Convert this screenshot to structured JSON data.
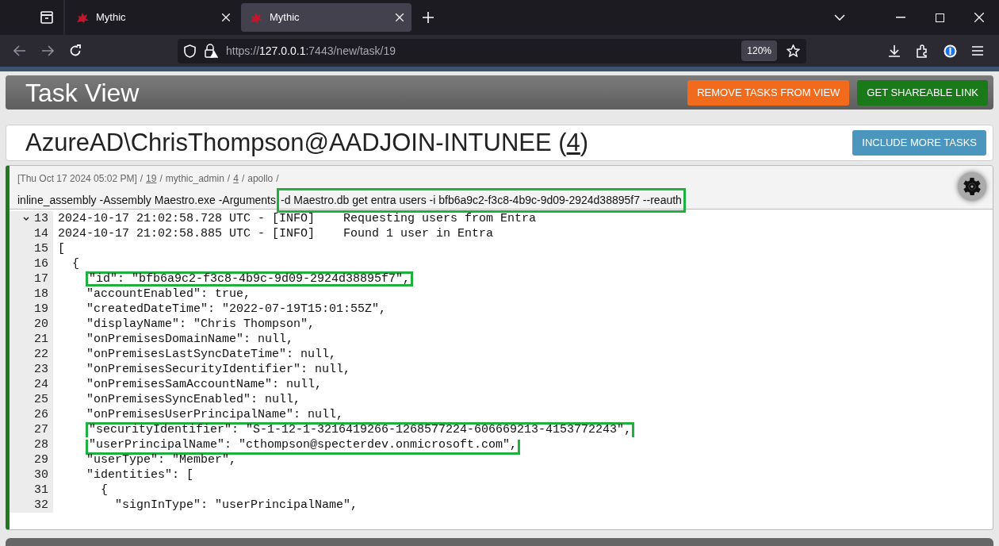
{
  "browser": {
    "tabs": [
      {
        "title": "Mythic",
        "selected": false
      },
      {
        "title": "Mythic",
        "selected": true
      }
    ],
    "url_host": "127.0.0.1",
    "url_prefix": "https://",
    "url_rest": ":7443/new/task/19",
    "zoom": "120%"
  },
  "header": {
    "title": "Task View",
    "buttons": [
      {
        "label": "REMOVE TASKS FROM VIEW",
        "kind": "orange"
      },
      {
        "label": "GET SHAREABLE LINK",
        "kind": "green"
      }
    ]
  },
  "callback": {
    "title_prefix": "AzureAD\\ChrisThompson@AADJOIN-INTUNEE (",
    "number": "4",
    "title_suffix": ")",
    "button": "INCLUDE MORE TASKS"
  },
  "task": {
    "separator": "/",
    "timestamp": "[Thu Oct 17 2024 05:02 PM]",
    "task_id": "19",
    "operator": "mythic_admin",
    "callback_id": "4",
    "payload": "apollo",
    "command": "inline_assembly -Assembly Maestro.exe -Arguments",
    "arguments": "-d Maestro.db get entra users -i bfb6a9c2-f3c8-4b9c-9d09-2924d38895f7 --reauth",
    "arguments_highlighted": true
  },
  "output": {
    "lines": [
      {
        "number": "13",
        "text": "2024-10-17 21:02:58.728 UTC - [INFO]    Requesting users from Entra",
        "highlighted": false,
        "foldable": true
      },
      {
        "number": "14",
        "text": "2024-10-17 21:02:58.885 UTC - [INFO]    Found 1 user in Entra",
        "highlighted": false,
        "foldable": false
      },
      {
        "number": "15",
        "text": "[",
        "highlighted": false,
        "foldable": false
      },
      {
        "number": "16",
        "text": "  {",
        "highlighted": false,
        "foldable": false
      },
      {
        "number": "17",
        "text": "    \"id\": \"bfb6a9c2-f3c8-4b9c-9d09-2924d38895f7\",",
        "highlighted": true,
        "foldable": false
      },
      {
        "number": "18",
        "text": "    \"accountEnabled\": true,",
        "highlighted": false,
        "foldable": false
      },
      {
        "number": "19",
        "text": "    \"createdDateTime\": \"2022-07-19T15:01:55Z\",",
        "highlighted": false,
        "foldable": false
      },
      {
        "number": "20",
        "text": "    \"displayName\": \"Chris Thompson\",",
        "highlighted": false,
        "foldable": false
      },
      {
        "number": "21",
        "text": "    \"onPremisesDomainName\": null,",
        "highlighted": false,
        "foldable": false
      },
      {
        "number": "22",
        "text": "    \"onPremisesLastSyncDateTime\": null,",
        "highlighted": false,
        "foldable": false
      },
      {
        "number": "23",
        "text": "    \"onPremisesSecurityIdentifier\": null,",
        "highlighted": false,
        "foldable": false
      },
      {
        "number": "24",
        "text": "    \"onPremisesSamAccountName\": null,",
        "highlighted": false,
        "foldable": false
      },
      {
        "number": "25",
        "text": "    \"onPremisesSyncEnabled\": null,",
        "highlighted": false,
        "foldable": false
      },
      {
        "number": "26",
        "text": "    \"onPremisesUserPrincipalName\": null,",
        "highlighted": false,
        "foldable": false
      },
      {
        "number": "27",
        "text": "    \"securityIdentifier\": \"S-1-12-1-3216419266-1268577224-606669213-4153772243\",",
        "highlighted": true,
        "foldable": false
      },
      {
        "number": "28",
        "text": "    \"userPrincipalName\": \"cthompson@specterdev.onmicrosoft.com\",",
        "highlighted": true,
        "foldable": false
      },
      {
        "number": "29",
        "text": "    \"userType\": \"Member\",",
        "highlighted": false,
        "foldable": false
      },
      {
        "number": "30",
        "text": "    \"identities\": [",
        "highlighted": false,
        "foldable": false
      },
      {
        "number": "31",
        "text": "      {",
        "highlighted": false,
        "foldable": false
      },
      {
        "number": "32",
        "text": "        \"signInType\": \"userPrincipalName\",",
        "highlighted": false,
        "foldable": false
      }
    ]
  }
}
